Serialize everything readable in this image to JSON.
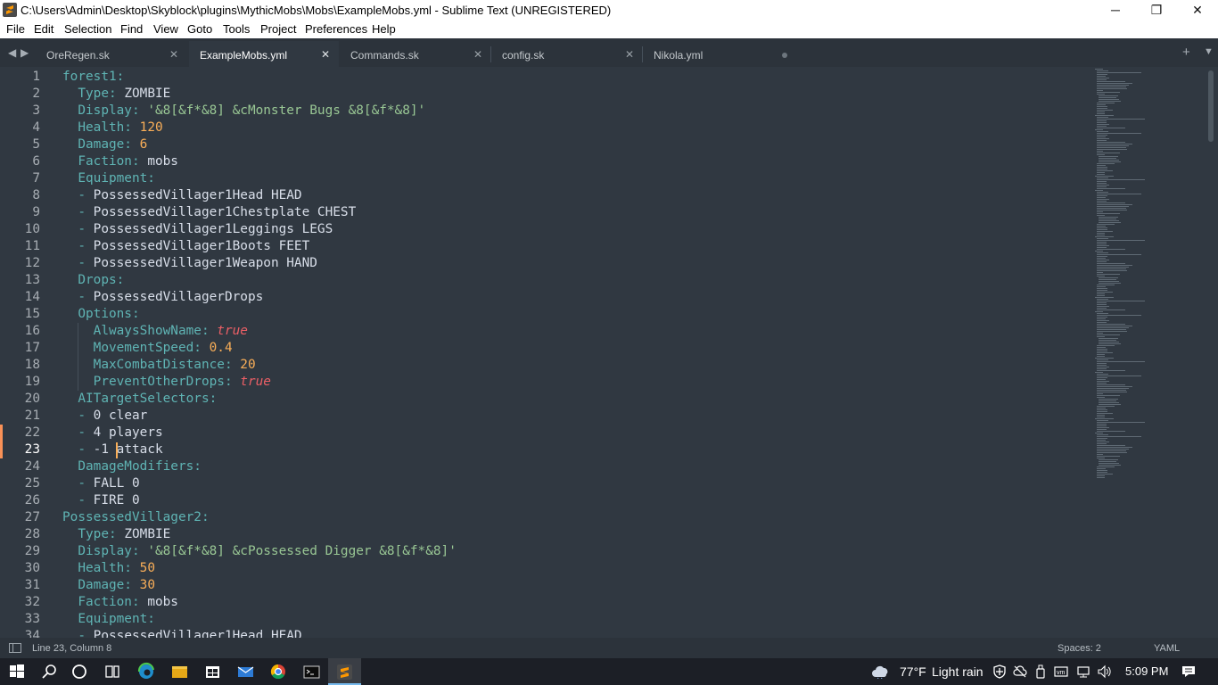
{
  "window": {
    "title": "C:\\Users\\Admin\\Desktop\\Skyblock\\plugins\\MythicMobs\\Mobs\\ExampleMobs.yml - Sublime Text (UNREGISTERED)",
    "minimize_glyph": "─",
    "maximize_glyph": "❐",
    "close_glyph": "✕"
  },
  "menu": [
    "File",
    "Edit",
    "Selection",
    "Find",
    "View",
    "Goto",
    "Tools",
    "Project",
    "Preferences",
    "Help"
  ],
  "tabs": [
    {
      "label": "OreRegen.sk",
      "close": "✕"
    },
    {
      "label": "ExampleMobs.yml",
      "close": "✕",
      "active": true
    },
    {
      "label": "Commands.sk",
      "close": "✕"
    },
    {
      "label": "config.sk",
      "close": "✕"
    },
    {
      "label": "Nikola.yml",
      "unsaved": true
    }
  ],
  "tabbar": {
    "nav_left": "◀",
    "nav_right": "▶",
    "new_tab": "+",
    "more": "▼"
  },
  "editor": {
    "current_line": 23,
    "lines": [
      "forest1:",
      "  Type: ZOMBIE",
      "  Display: '&8[&f*&8] &cMonster Bugs &8[&f*&8]'",
      "  Health: 120",
      "  Damage: 6",
      "  Faction: mobs",
      "  Equipment:",
      "  - PossessedVillager1Head HEAD",
      "  - PossessedVillager1Chestplate CHEST",
      "  - PossessedVillager1Leggings LEGS",
      "  - PossessedVillager1Boots FEET",
      "  - PossessedVillager1Weapon HAND",
      "  Drops:",
      "  - PossessedVillagerDrops",
      "  Options:",
      "    AlwaysShowName: true",
      "    MovementSpeed: 0.4",
      "    MaxCombatDistance: 20",
      "    PreventOtherDrops: true",
      "  AITargetSelectors:",
      "  - 0 clear",
      "  - 4 players",
      "  - -1 attack",
      "  DamageModifiers:",
      "  - FALL 0",
      "  - FIRE 0",
      "PossessedVillager2:",
      "  Type: ZOMBIE",
      "  Display: '&8[&f*&8] &cPossessed Digger &8[&f*&8]'",
      "  Health: 50",
      "  Damage: 30",
      "  Faction: mobs",
      "  Equipment:",
      "  - PossessedVillager1Head HEAD"
    ],
    "colors": {
      "background": "#303841",
      "key": "#5fb4b4",
      "number": "#f9ae58",
      "string": "#99c794",
      "boolean": "#ec5f66",
      "text": "#d8dee9"
    }
  },
  "status": {
    "position": "Line 23, Column 8",
    "indent": "Spaces: 2",
    "syntax": "YAML"
  },
  "taskbar": {
    "icons": [
      "windows-icon",
      "search-icon",
      "cortana-icon",
      "task-view-icon",
      "edge-icon",
      "file-explorer-icon",
      "store-icon",
      "mail-icon",
      "chrome-icon",
      "terminal-icon",
      "sublime-text-icon"
    ],
    "weather_temp": "77°F",
    "weather_desc": "Light rain",
    "clock": "5:09 PM"
  }
}
